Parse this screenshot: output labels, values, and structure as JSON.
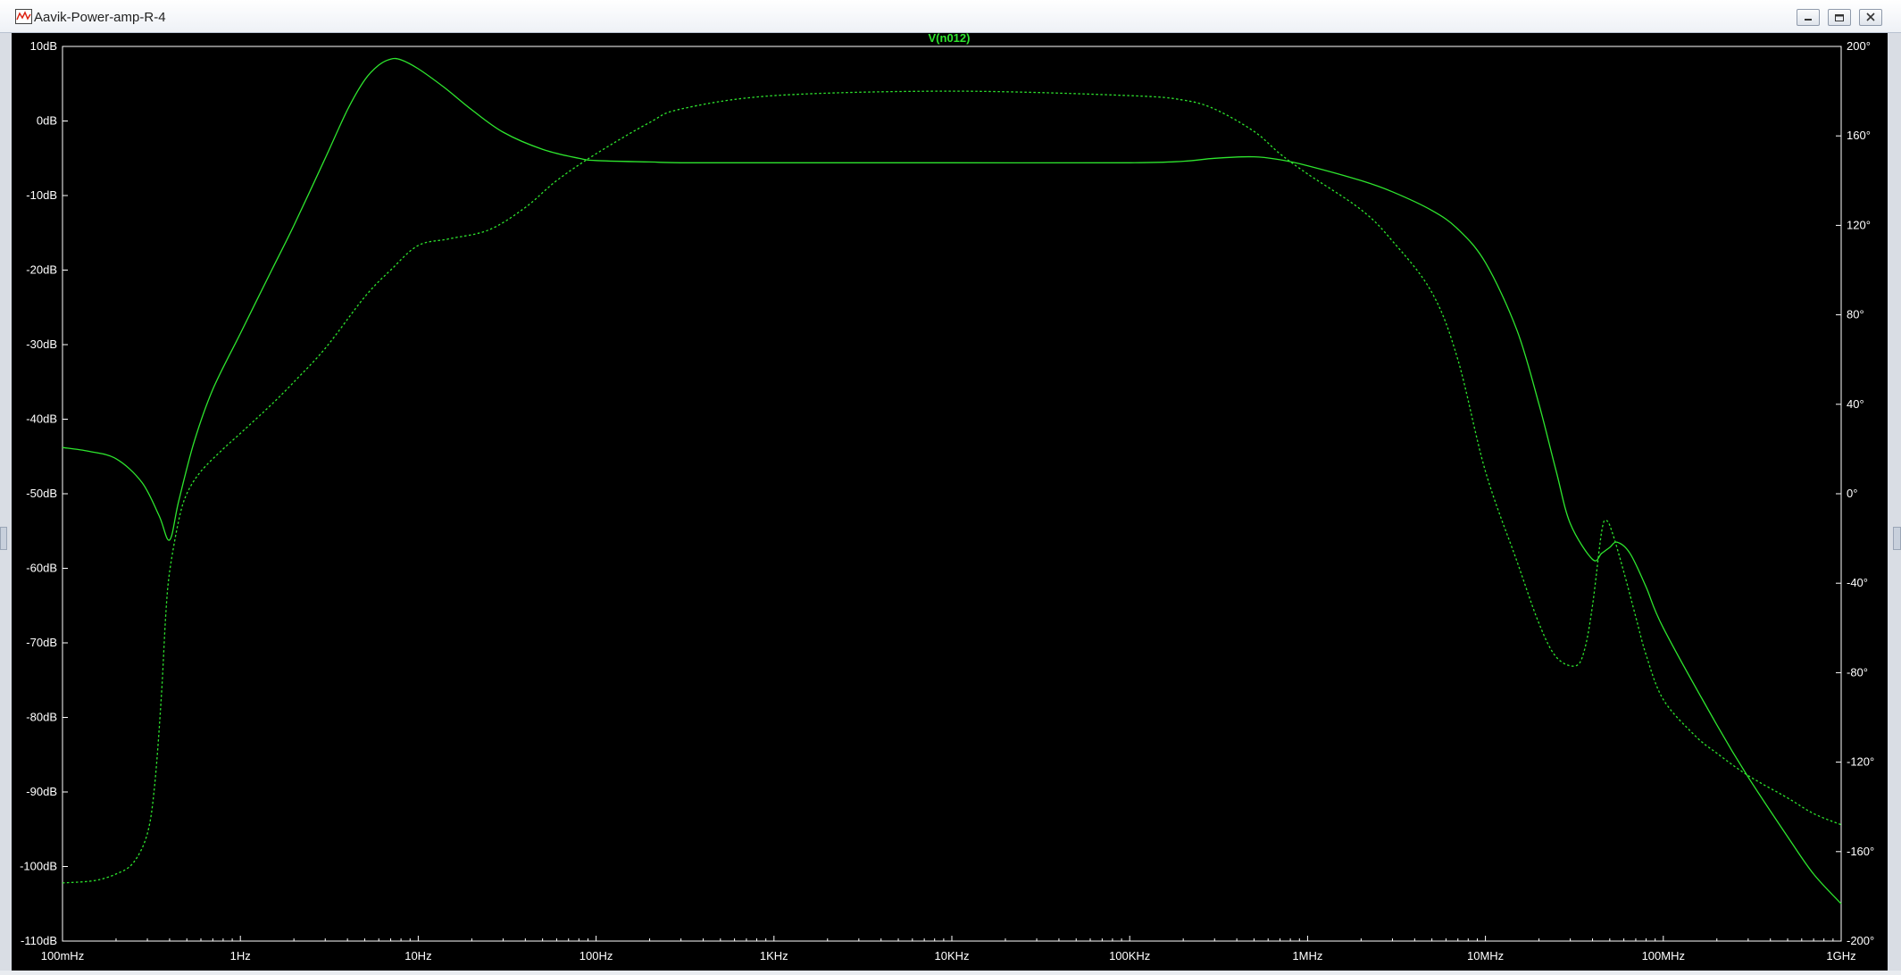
{
  "window": {
    "title": "Aavik-Power-amp-R-4",
    "icon": "waveform-plot-icon",
    "controls": [
      "minimize-icon",
      "restore-icon",
      "close-icon"
    ]
  },
  "colors": {
    "background": "#000000",
    "trace": "#2ee52e",
    "axis_text": "#ffffff",
    "title_text": "#2ee52e"
  },
  "chart_data": {
    "type": "line",
    "title": "V(n012)",
    "xscale": "log",
    "xlim": [
      0.1,
      1000000000
    ],
    "x_tick_labels": [
      "100mHz",
      "1Hz",
      "10Hz",
      "100Hz",
      "1KHz",
      "10KHz",
      "100KHz",
      "1MHz",
      "10MHz",
      "100MHz",
      "1GHz"
    ],
    "x_tick_values": [
      0.1,
      1,
      10,
      100,
      1000,
      10000,
      100000,
      1000000,
      10000000,
      100000000,
      1000000000
    ],
    "ylim_left": [
      -110,
      10
    ],
    "y_left_tick_labels": [
      "10dB",
      "0dB",
      "-10dB",
      "-20dB",
      "-30dB",
      "-40dB",
      "-50dB",
      "-60dB",
      "-70dB",
      "-80dB",
      "-90dB",
      "-100dB",
      "-110dB"
    ],
    "y_left_tick_values": [
      10,
      0,
      -10,
      -20,
      -30,
      -40,
      -50,
      -60,
      -70,
      -80,
      -90,
      -100,
      -110
    ],
    "ylim_right": [
      -200,
      200
    ],
    "y_right_tick_labels": [
      "200°",
      "160°",
      "120°",
      "80°",
      "40°",
      "0°",
      "-40°",
      "-80°",
      "-120°",
      "-160°",
      "-200°"
    ],
    "y_right_tick_values": [
      200,
      160,
      120,
      80,
      40,
      0,
      -40,
      -80,
      -120,
      -160,
      -200
    ],
    "grid": false,
    "series": [
      {
        "style": "solid",
        "axis": "left",
        "points": [
          [
            0.1,
            -43.8
          ],
          [
            0.14,
            -44.3
          ],
          [
            0.2,
            -45.3
          ],
          [
            0.28,
            -48.5
          ],
          [
            0.35,
            -53
          ],
          [
            0.4,
            -56.2
          ],
          [
            0.45,
            -51
          ],
          [
            0.55,
            -43
          ],
          [
            0.7,
            -36
          ],
          [
            1,
            -28.5
          ],
          [
            1.5,
            -20
          ],
          [
            2,
            -14
          ],
          [
            3,
            -5
          ],
          [
            4,
            1.5
          ],
          [
            5,
            5.5
          ],
          [
            6,
            7.5
          ],
          [
            7,
            8.3
          ],
          [
            8,
            8.2
          ],
          [
            10,
            7
          ],
          [
            14,
            4.5
          ],
          [
            20,
            1.5
          ],
          [
            30,
            -1.5
          ],
          [
            50,
            -3.8
          ],
          [
            80,
            -5
          ],
          [
            100,
            -5.3
          ],
          [
            200,
            -5.5
          ],
          [
            300,
            -5.6
          ],
          [
            1000,
            -5.6
          ],
          [
            10000,
            -5.6
          ],
          [
            100000,
            -5.6
          ],
          [
            200000,
            -5.4
          ],
          [
            300000,
            -5
          ],
          [
            500000,
            -4.8
          ],
          [
            700000,
            -5.2
          ],
          [
            1000000,
            -6
          ],
          [
            2000000,
            -8
          ],
          [
            3000000,
            -9.5
          ],
          [
            5000000,
            -12
          ],
          [
            7000000,
            -14.5
          ],
          [
            10000000,
            -19
          ],
          [
            15000000,
            -28
          ],
          [
            20000000,
            -38
          ],
          [
            25000000,
            -47
          ],
          [
            30000000,
            -54
          ],
          [
            40000000,
            -58.8
          ],
          [
            45000000,
            -58
          ],
          [
            50000000,
            -57.2
          ],
          [
            55000000,
            -56.5
          ],
          [
            65000000,
            -58
          ],
          [
            80000000,
            -62.5
          ],
          [
            100000000,
            -68
          ],
          [
            200000000,
            -81
          ],
          [
            300000000,
            -88
          ],
          [
            500000000,
            -96
          ],
          [
            700000000,
            -101
          ],
          [
            1000000000,
            -105
          ]
        ]
      },
      {
        "style": "dashed",
        "axis": "right",
        "points": [
          [
            0.1,
            -174
          ],
          [
            0.15,
            -173
          ],
          [
            0.2,
            -170
          ],
          [
            0.25,
            -165
          ],
          [
            0.3,
            -152
          ],
          [
            0.33,
            -130
          ],
          [
            0.36,
            -90
          ],
          [
            0.38,
            -55
          ],
          [
            0.4,
            -35
          ],
          [
            0.45,
            -12
          ],
          [
            0.5,
            0
          ],
          [
            0.6,
            10
          ],
          [
            0.8,
            20
          ],
          [
            1,
            27
          ],
          [
            1.5,
            40
          ],
          [
            2,
            50
          ],
          [
            3,
            65
          ],
          [
            5,
            88
          ],
          [
            7,
            100
          ],
          [
            10,
            111
          ],
          [
            15,
            114
          ],
          [
            25,
            118
          ],
          [
            40,
            128
          ],
          [
            60,
            140
          ],
          [
            100,
            152
          ],
          [
            200,
            166
          ],
          [
            300,
            172
          ],
          [
            1000,
            178
          ],
          [
            10000,
            180
          ],
          [
            100000,
            178
          ],
          [
            200000,
            176
          ],
          [
            300000,
            172
          ],
          [
            500000,
            162
          ],
          [
            700000,
            152
          ],
          [
            1000000,
            143
          ],
          [
            2000000,
            127
          ],
          [
            3000000,
            113
          ],
          [
            5000000,
            90
          ],
          [
            7000000,
            60
          ],
          [
            10000000,
            10
          ],
          [
            15000000,
            -30
          ],
          [
            20000000,
            -58
          ],
          [
            25000000,
            -73
          ],
          [
            32000000,
            -77
          ],
          [
            36000000,
            -70
          ],
          [
            40000000,
            -50
          ],
          [
            45000000,
            -17
          ],
          [
            48000000,
            -12
          ],
          [
            52000000,
            -18
          ],
          [
            60000000,
            -35
          ],
          [
            70000000,
            -55
          ],
          [
            80000000,
            -72
          ],
          [
            100000000,
            -92
          ],
          [
            150000000,
            -108
          ],
          [
            200000000,
            -116
          ],
          [
            300000000,
            -126
          ],
          [
            500000000,
            -136
          ],
          [
            700000000,
            -143
          ],
          [
            1000000000,
            -148
          ]
        ]
      }
    ]
  }
}
